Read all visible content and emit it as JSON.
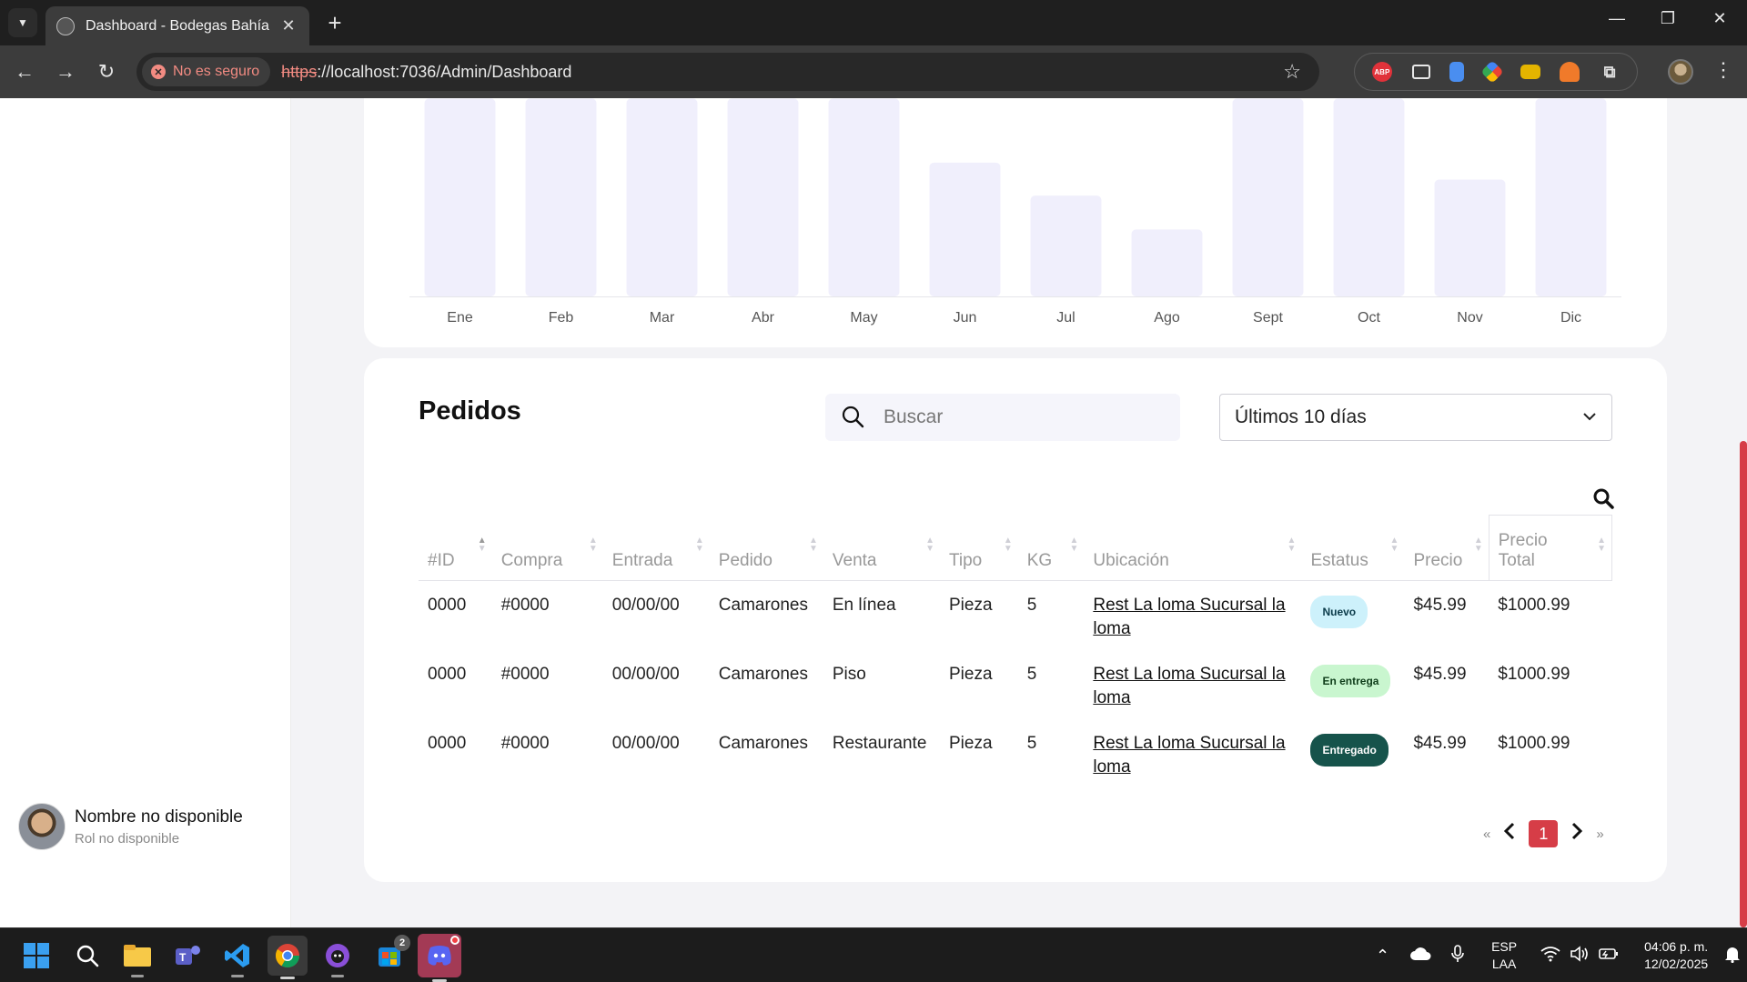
{
  "browser": {
    "tab_title": "Dashboard - Bodegas Bahía",
    "security_label": "No es seguro",
    "url_scheme": "https",
    "url_rest": "://localhost:7036/Admin/Dashboard"
  },
  "sidebar": {
    "user_name": "Nombre no disponible",
    "user_role": "Rol no disponible"
  },
  "chart_data": {
    "type": "bar",
    "categories": [
      "Ene",
      "Feb",
      "Mar",
      "Abr",
      "May",
      "Jun",
      "Jul",
      "Ago",
      "Sept",
      "Oct",
      "Nov",
      "Dic"
    ],
    "values": [
      210,
      210,
      210,
      210,
      210,
      142,
      107,
      71,
      210,
      210,
      124,
      210
    ],
    "ylim": [
      0,
      220
    ],
    "bar_color": "#f0effc",
    "note_top_clipped": true
  },
  "orders": {
    "title": "Pedidos",
    "search_placeholder": "Buscar",
    "range_value": "Últimos 10 días",
    "columns": [
      "#ID",
      "Compra",
      "Entrada",
      "Pedido",
      "Venta",
      "Tipo",
      "KG",
      "Ubicación",
      "Estatus",
      "Precio",
      "Precio Total"
    ],
    "rows": [
      {
        "id": "0000",
        "compra": "#0000",
        "entrada": "00/00/00",
        "pedido": "Camarones",
        "venta": "En línea",
        "tipo": "Pieza",
        "kg": "5",
        "ubicacion": "Rest La loma Sucursal la loma",
        "estatus": "Nuevo",
        "precio": "$45.99",
        "total": "$1000.99"
      },
      {
        "id": "0000",
        "compra": "#0000",
        "entrada": "00/00/00",
        "pedido": "Camarones",
        "venta": "Piso",
        "tipo": "Pieza",
        "kg": "5",
        "ubicacion": "Rest La loma Sucursal la loma",
        "estatus": "En entrega",
        "precio": "$45.99",
        "total": "$1000.99"
      },
      {
        "id": "0000",
        "compra": "#0000",
        "entrada": "00/00/00",
        "pedido": "Camarones",
        "venta": "Restaurante",
        "tipo": "Pieza",
        "kg": "5",
        "ubicacion": "Rest La loma Sucursal la loma",
        "estatus": "Entregado",
        "precio": "$45.99",
        "total": "$1000.99"
      }
    ],
    "status_colors": {
      "Nuevo": {
        "bg": "#cdf1fb",
        "fg": "#0b3b4a"
      },
      "En entrega": {
        "bg": "#c9f6cf",
        "fg": "#0f3d1a"
      },
      "Entregado": {
        "bg": "#16534b",
        "fg": "#ffffff"
      }
    },
    "pagination": {
      "first": "«",
      "last": "»",
      "current": "1"
    }
  },
  "taskbar": {
    "teams_badge": "2",
    "lang_top": "ESP",
    "lang_bottom": "LAA",
    "time": "04:06 p. m.",
    "date": "12/02/2025"
  },
  "colors": {
    "accent": "#d63d47"
  }
}
